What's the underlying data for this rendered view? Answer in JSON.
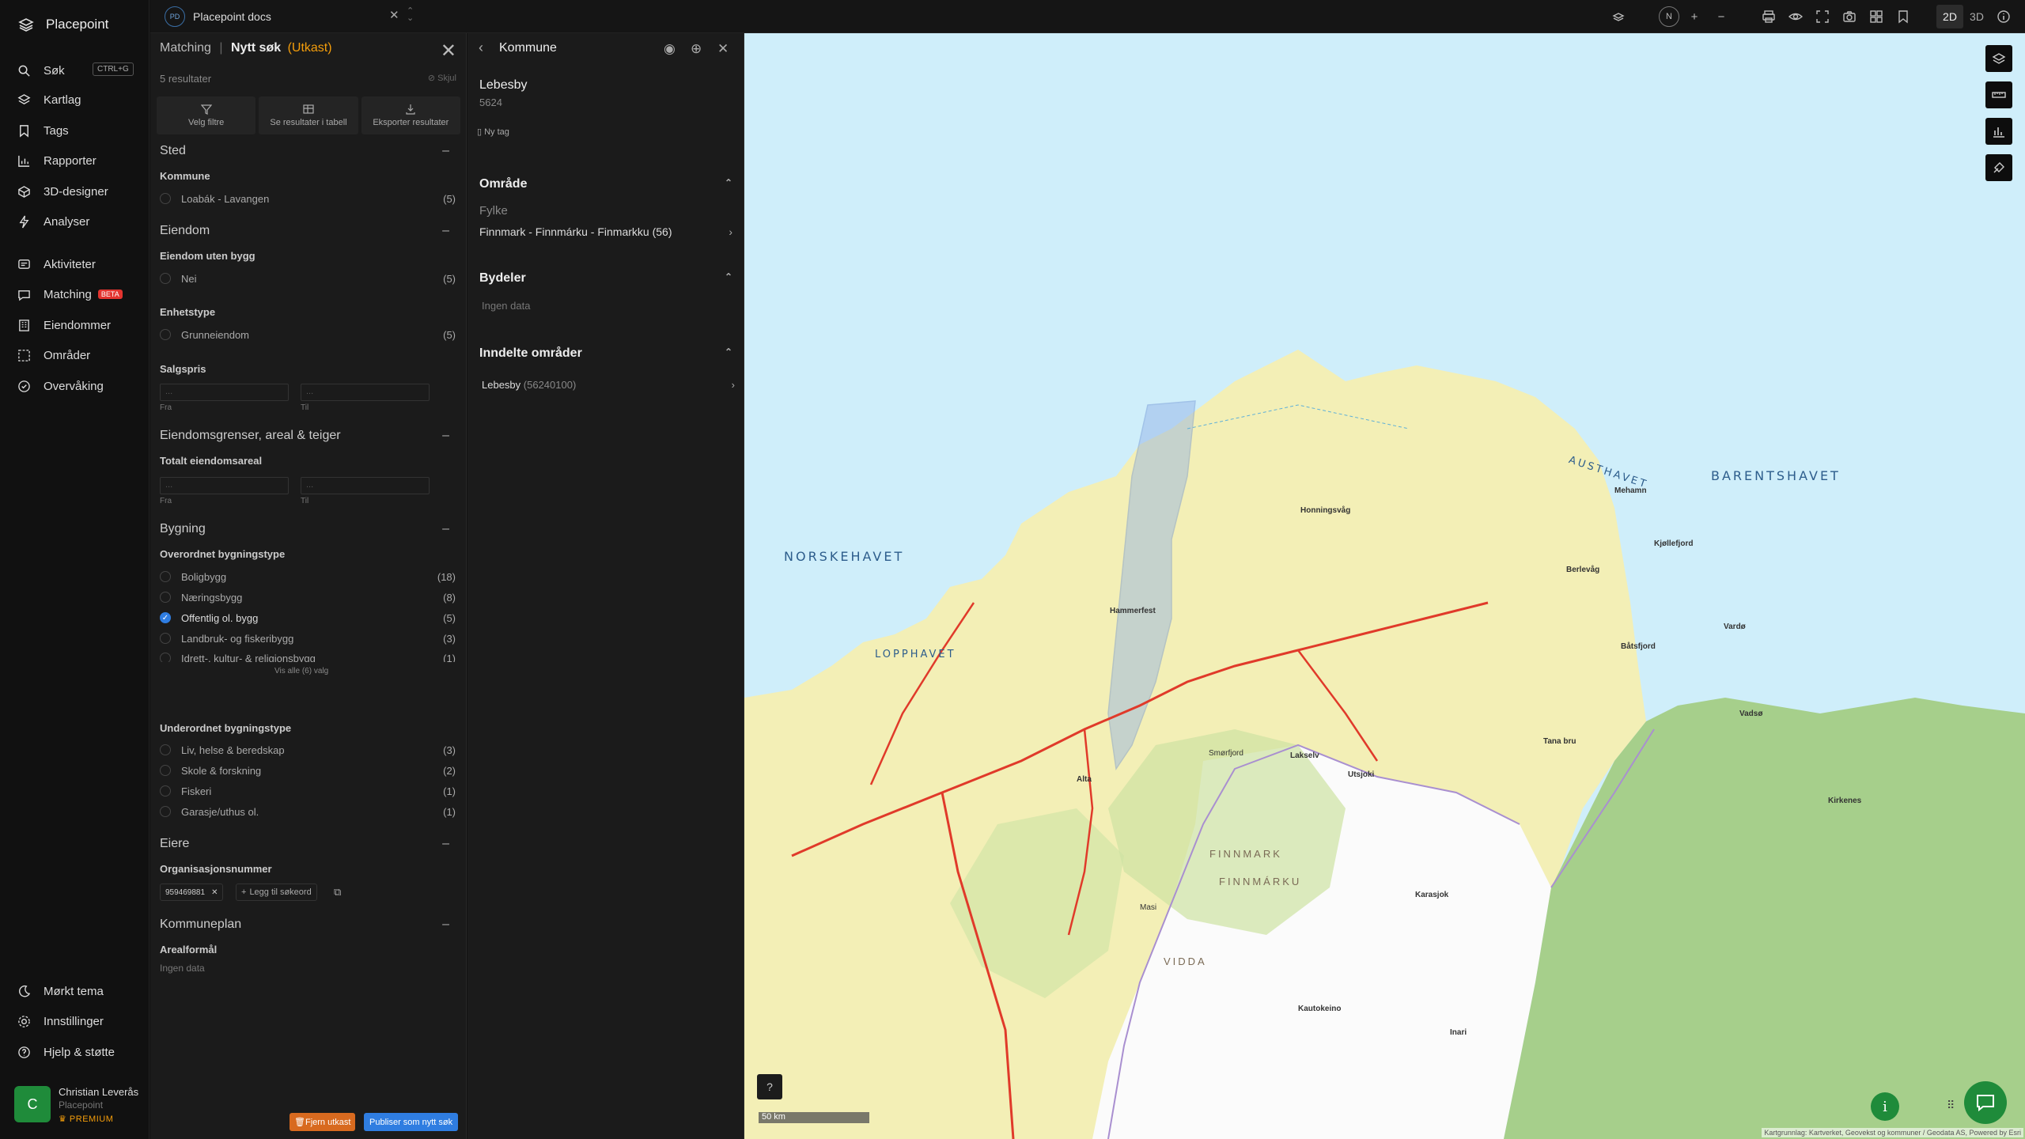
{
  "app": {
    "name": "Placepoint"
  },
  "sidebar": {
    "search_label": "Søk",
    "search_shortcut": "CTRL+G",
    "items": [
      {
        "label": "Kartlag"
      },
      {
        "label": "Tags"
      },
      {
        "label": "Rapporter"
      },
      {
        "label": "3D-designer"
      },
      {
        "label": "Analyser"
      },
      {
        "label": "Aktiviteter"
      },
      {
        "label": "Matching",
        "badge": "BETA"
      },
      {
        "label": "Eiendommer"
      },
      {
        "label": "Områder"
      },
      {
        "label": "Overvåking"
      }
    ],
    "bottom": [
      {
        "label": "Mørkt tema"
      },
      {
        "label": "Innstillinger"
      },
      {
        "label": "Hjelp & støtte"
      }
    ],
    "user": {
      "initial": "C",
      "name": "Christian Leverås",
      "org": "Placepoint",
      "plan": "PREMIUM"
    }
  },
  "topbar": {
    "tab_badge": "PD",
    "tab_title": "Placepoint docs",
    "compass": "N",
    "mode_2d": "2D",
    "mode_3d": "3D"
  },
  "search_panel": {
    "crumb": "Matching",
    "sep": "|",
    "title": "Nytt søk",
    "status": "(Utkast)",
    "results": "5 resultater",
    "hide": "Skjul",
    "actions": {
      "filters": "Velg filtre",
      "table": "Se resultater i tabell",
      "export": "Eksporter resultater"
    },
    "sections": {
      "sted": "Sted",
      "eiendom": "Eiendom",
      "eiendomsgrenser": "Eiendomsgrenser, areal & teiger",
      "bygning": "Bygning",
      "eiere": "Eiere",
      "kommuneplan": "Kommuneplan"
    },
    "kommune": {
      "label": "Kommune",
      "options": [
        {
          "label": "Loabák - Lavangen",
          "count": "(5)"
        }
      ]
    },
    "uten_bygg": {
      "label": "Eiendom uten bygg",
      "options": [
        {
          "label": "Nei",
          "count": "(5)"
        }
      ]
    },
    "enhetstype": {
      "label": "Enhetstype",
      "options": [
        {
          "label": "Grunneiendom",
          "count": "(5)"
        }
      ]
    },
    "salgspris": {
      "label": "Salgspris",
      "from": "Fra",
      "to": "Til",
      "placeholder": "..."
    },
    "areal": {
      "label": "Totalt eiendomsareal",
      "from": "Fra",
      "to": "Til",
      "placeholder": "..."
    },
    "overordnet": {
      "label": "Overordnet bygningstype",
      "options": [
        {
          "label": "Boligbygg",
          "count": "(18)",
          "checked": false
        },
        {
          "label": "Næringsbygg",
          "count": "(8)",
          "checked": false
        },
        {
          "label": "Offentlig ol. bygg",
          "count": "(5)",
          "checked": true
        },
        {
          "label": "Landbruk- og fiskeribygg",
          "count": "(3)",
          "checked": false
        },
        {
          "label": "Idrett-, kultur- & religionsbygg",
          "count": "(1)",
          "checked": false
        }
      ],
      "show_all": "Vis alle (6) valg"
    },
    "underordnet": {
      "label": "Underordnet bygningstype",
      "options": [
        {
          "label": "Liv, helse & beredskap",
          "count": "(3)"
        },
        {
          "label": "Skole & forskning",
          "count": "(2)"
        },
        {
          "label": "Fiskeri",
          "count": "(1)"
        },
        {
          "label": "Garasje/uthus ol.",
          "count": "(1)"
        }
      ]
    },
    "org": {
      "label": "Organisasjonsnummer",
      "chip": "959469881",
      "add": "Legg til søkeord"
    },
    "arealformal": {
      "label": "Arealformål",
      "value": "Ingen data"
    },
    "buttons": {
      "remove": "Fjern utkast",
      "publish": "Publiser som nytt søk"
    }
  },
  "kommune_panel": {
    "title": "Kommune",
    "name": "Lebesby",
    "code": "5624",
    "new_tag": "Ny tag",
    "omrade": {
      "title": "Område",
      "fylke_label": "Fylke",
      "fylke_value": "Finnmark - Finnmárku - Finmarkku",
      "fylke_count": "(56)"
    },
    "bydeler": {
      "title": "Bydeler",
      "value": "Ingen data"
    },
    "inndelte": {
      "title": "Inndelte områder",
      "item": "Lebesby",
      "item_code": "(56240100)"
    }
  },
  "map": {
    "seas": [
      "NORSKEHAVET",
      "BARENTSHAVET",
      "AUSTHAVET",
      "LOPPHAVET"
    ],
    "towns": [
      "Hammerfest",
      "Alta",
      "Lakselv",
      "Kautokeino",
      "Karasjok",
      "Vadsø",
      "Kirkenes",
      "Honningsvåg",
      "Mehamn",
      "Kjøllefjord",
      "Berlevåg",
      "Båtsfjord",
      "Vardø",
      "Tana bru",
      "Inari",
      "Utsjoki",
      "Smørfjord",
      "Masi"
    ],
    "regions": [
      "FINNMARK",
      "FINNMÁRKU",
      "VIDDA"
    ],
    "scale": "50 km",
    "attribution": "Kartgrunnlag: Kartverket, Geovekst og kommuner / Geodata AS, Powered by Esri",
    "colors": {
      "sea": "#cfeefa",
      "land": "#f4f0b8",
      "green": "#b9d98e",
      "road": "#e03a2a",
      "highlight": "#8fb0e8"
    }
  }
}
